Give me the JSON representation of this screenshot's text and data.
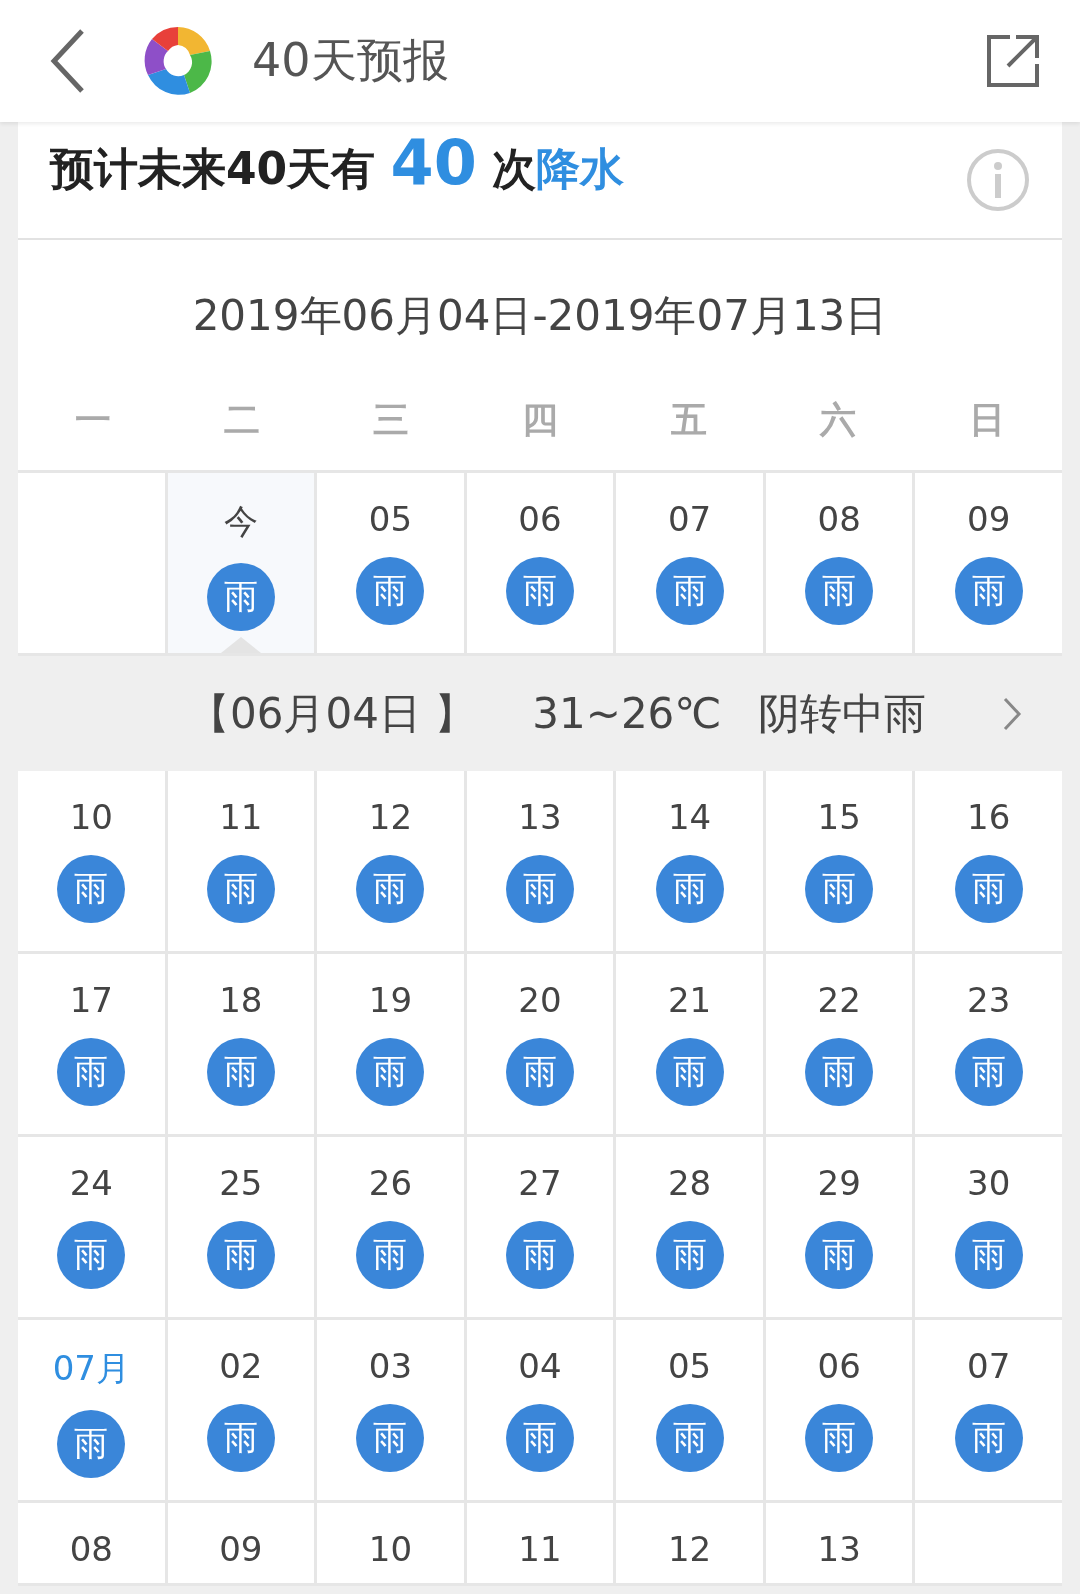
{
  "header": {
    "title": "40天预报"
  },
  "summary": {
    "lead": "预计未来40天有",
    "count": "40",
    "unit": "次",
    "kind_text": "降水"
  },
  "calendar": {
    "range": "2019年06月04日-2019年07月13日",
    "weekdays": [
      "一",
      "二",
      "三",
      "四",
      "五",
      "六",
      "日"
    ],
    "weeks": [
      [
        {
          "kind": "empty"
        },
        {
          "kind": "day",
          "label": "今",
          "weather": "雨",
          "selected": true
        },
        {
          "kind": "day",
          "label": "05",
          "weather": "雨",
          "selected": false
        },
        {
          "kind": "day",
          "label": "06",
          "weather": "雨",
          "selected": false
        },
        {
          "kind": "day",
          "label": "07",
          "weather": "雨",
          "selected": false
        },
        {
          "kind": "day",
          "label": "08",
          "weather": "雨",
          "selected": false
        },
        {
          "kind": "day",
          "label": "09",
          "weather": "雨",
          "selected": false
        }
      ],
      [
        {
          "kind": "day",
          "label": "10",
          "weather": "雨",
          "selected": false
        },
        {
          "kind": "day",
          "label": "11",
          "weather": "雨",
          "selected": false
        },
        {
          "kind": "day",
          "label": "12",
          "weather": "雨",
          "selected": false
        },
        {
          "kind": "day",
          "label": "13",
          "weather": "雨",
          "selected": false
        },
        {
          "kind": "day",
          "label": "14",
          "weather": "雨",
          "selected": false
        },
        {
          "kind": "day",
          "label": "15",
          "weather": "雨",
          "selected": false
        },
        {
          "kind": "day",
          "label": "16",
          "weather": "雨",
          "selected": false
        }
      ],
      [
        {
          "kind": "day",
          "label": "17",
          "weather": "雨",
          "selected": false
        },
        {
          "kind": "day",
          "label": "18",
          "weather": "雨",
          "selected": false
        },
        {
          "kind": "day",
          "label": "19",
          "weather": "雨",
          "selected": false
        },
        {
          "kind": "day",
          "label": "20",
          "weather": "雨",
          "selected": false
        },
        {
          "kind": "day",
          "label": "21",
          "weather": "雨",
          "selected": false
        },
        {
          "kind": "day",
          "label": "22",
          "weather": "雨",
          "selected": false
        },
        {
          "kind": "day",
          "label": "23",
          "weather": "雨",
          "selected": false
        }
      ],
      [
        {
          "kind": "day",
          "label": "24",
          "weather": "雨",
          "selected": false
        },
        {
          "kind": "day",
          "label": "25",
          "weather": "雨",
          "selected": false
        },
        {
          "kind": "day",
          "label": "26",
          "weather": "雨",
          "selected": false
        },
        {
          "kind": "day",
          "label": "27",
          "weather": "雨",
          "selected": false
        },
        {
          "kind": "day",
          "label": "28",
          "weather": "雨",
          "selected": false
        },
        {
          "kind": "day",
          "label": "29",
          "weather": "雨",
          "selected": false
        },
        {
          "kind": "day",
          "label": "30",
          "weather": "雨",
          "selected": false
        }
      ],
      [
        {
          "kind": "month",
          "label": "07月",
          "weather": "雨",
          "selected": false
        },
        {
          "kind": "day",
          "label": "02",
          "weather": "雨",
          "selected": false
        },
        {
          "kind": "day",
          "label": "03",
          "weather": "雨",
          "selected": false
        },
        {
          "kind": "day",
          "label": "04",
          "weather": "雨",
          "selected": false
        },
        {
          "kind": "day",
          "label": "05",
          "weather": "雨",
          "selected": false
        },
        {
          "kind": "day",
          "label": "06",
          "weather": "雨",
          "selected": false
        },
        {
          "kind": "day",
          "label": "07",
          "weather": "雨",
          "selected": false
        }
      ],
      [
        {
          "kind": "day",
          "label": "08",
          "selected": false
        },
        {
          "kind": "day",
          "label": "09",
          "selected": false
        },
        {
          "kind": "day",
          "label": "10",
          "selected": false
        },
        {
          "kind": "day",
          "label": "11",
          "selected": false
        },
        {
          "kind": "day",
          "label": "12",
          "selected": false
        },
        {
          "kind": "day",
          "label": "13",
          "selected": false
        },
        {
          "kind": "empty"
        }
      ]
    ],
    "detail": {
      "date": "【06月04日 】",
      "temp": "31~26℃",
      "weather": "阴转中雨"
    }
  }
}
